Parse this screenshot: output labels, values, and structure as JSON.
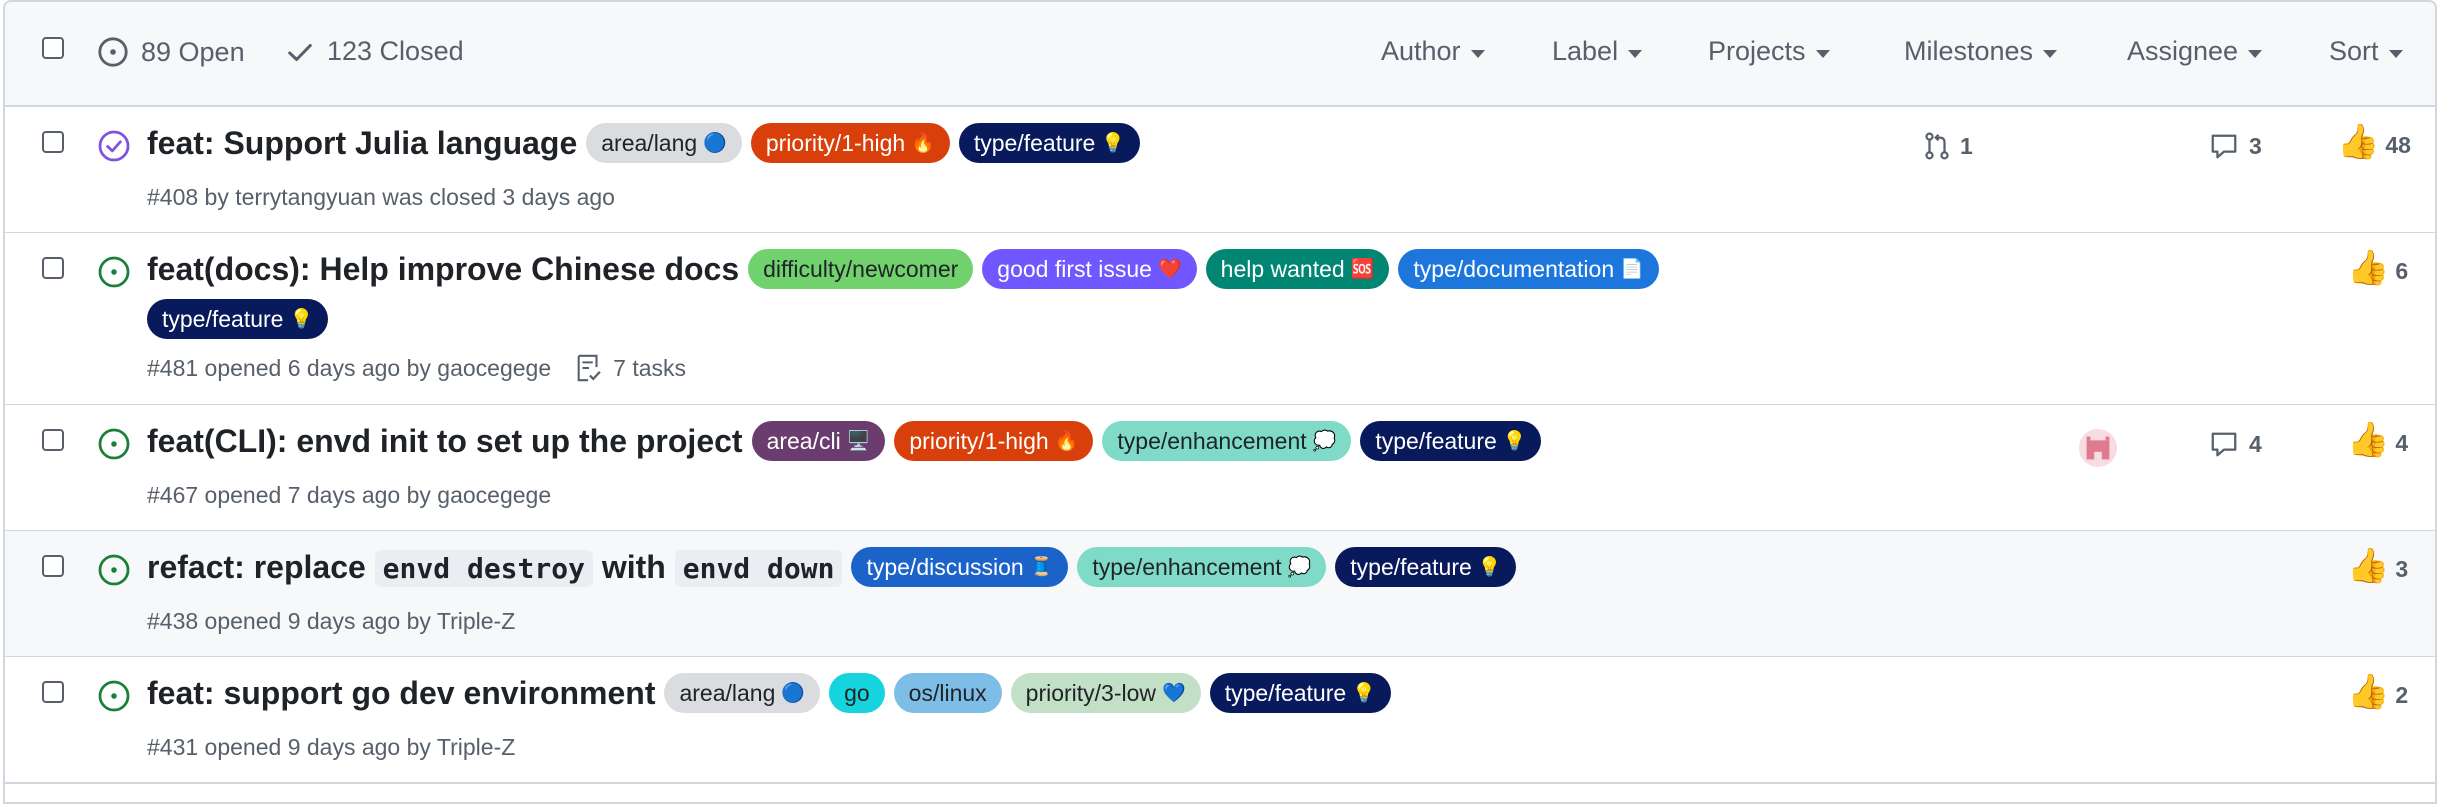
{
  "header": {
    "open_label": "89 Open",
    "closed_label": "123 Closed",
    "filters": [
      "Author",
      "Label",
      "Projects",
      "Milestones",
      "Assignee",
      "Sort"
    ]
  },
  "issues": [
    {
      "state": "closed",
      "title": "feat: Support Julia language",
      "labels": [
        {
          "text": "area/lang",
          "emoji": "🔵",
          "bg": "#dadcdf",
          "fg": "#1f2328"
        },
        {
          "text": "priority/1-high",
          "emoji": "🔥",
          "bg": "#d93f0b",
          "fg": "#ffffff"
        },
        {
          "text": "type/feature",
          "emoji": "💡",
          "bg": "#091a5c",
          "fg": "#ffffff"
        }
      ],
      "meta": "#408 by terrytangyuan was closed 3 days ago",
      "linked_prs": "1",
      "comments": "3",
      "reactions": "48"
    },
    {
      "state": "open",
      "title": "feat(docs): Help improve Chinese docs",
      "labels": [
        {
          "text": "difficulty/newcomer",
          "emoji": "",
          "bg": "#71d16c",
          "fg": "#1f2328"
        },
        {
          "text": "good first issue",
          "emoji": "❤️",
          "bg": "#7057ff",
          "fg": "#ffffff"
        },
        {
          "text": "help wanted",
          "emoji": "🆘",
          "bg": "#008672",
          "fg": "#ffffff"
        },
        {
          "text": "type/documentation",
          "emoji": "📄",
          "bg": "#1d76db",
          "fg": "#ffffff"
        },
        {
          "text": "type/feature",
          "emoji": "💡",
          "bg": "#091a5c",
          "fg": "#ffffff"
        }
      ],
      "meta": "#481 opened 6 days ago by gaocegege",
      "tasks": "7 tasks",
      "reactions": "6"
    },
    {
      "state": "open",
      "title": "feat(CLI): envd init to set up the project",
      "labels": [
        {
          "text": "area/cli",
          "emoji": "🖥️",
          "bg": "#6b3c6e",
          "fg": "#ffffff"
        },
        {
          "text": "priority/1-high",
          "emoji": "🔥",
          "bg": "#d93f0b",
          "fg": "#ffffff"
        },
        {
          "text": "type/enhancement",
          "emoji": "💭",
          "bg": "#7fdbc8",
          "fg": "#1f2328"
        },
        {
          "text": "type/feature",
          "emoji": "💡",
          "bg": "#091a5c",
          "fg": "#ffffff"
        }
      ],
      "meta": "#467 opened 7 days ago by gaocegege",
      "comments": "4",
      "reactions": "4"
    },
    {
      "state": "open",
      "title_parts": [
        "refact: replace ",
        "envd destroy",
        " with ",
        "envd down"
      ],
      "labels": [
        {
          "text": "type/discussion",
          "emoji": "🧵",
          "bg": "#1b63c9",
          "fg": "#ffffff"
        },
        {
          "text": "type/enhancement",
          "emoji": "💭",
          "bg": "#7fdbc8",
          "fg": "#1f2328"
        },
        {
          "text": "type/feature",
          "emoji": "💡",
          "bg": "#091a5c",
          "fg": "#ffffff"
        }
      ],
      "meta": "#438 opened 9 days ago by Triple-Z",
      "reactions": "3"
    },
    {
      "state": "open",
      "title": "feat: support go dev environment",
      "labels": [
        {
          "text": "area/lang",
          "emoji": "🔵",
          "bg": "#dadcdf",
          "fg": "#1f2328"
        },
        {
          "text": "go",
          "emoji": "",
          "bg": "#16d4dd",
          "fg": "#1f2328"
        },
        {
          "text": "os/linux",
          "emoji": "",
          "bg": "#7ebee6",
          "fg": "#1f2328"
        },
        {
          "text": "priority/3-low",
          "emoji": "💙",
          "bg": "#c2e0c6",
          "fg": "#1f2328"
        },
        {
          "text": "type/feature",
          "emoji": "💡",
          "bg": "#091a5c",
          "fg": "#ffffff"
        }
      ],
      "meta": "#431 opened 9 days ago by Triple-Z",
      "reactions": "2"
    }
  ],
  "colors": {
    "open_green": "#1a7f37",
    "closed_purple": "#8250df",
    "muted": "#57606a",
    "border": "#d0d7de"
  }
}
